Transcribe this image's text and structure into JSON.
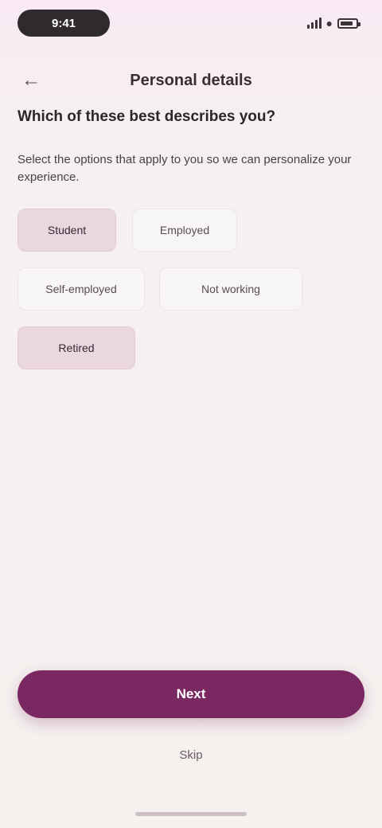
{
  "status_bar": {
    "time": "9:41"
  },
  "header": {
    "back_icon": "back-arrow-icon",
    "title": "Personal details"
  },
  "content": {
    "heading": "Which of these best describes you?",
    "description": "Select the options that apply to you so we can personalize your experience.",
    "chips": [
      {
        "label": "Student",
        "selected": true
      },
      {
        "label": "Employed",
        "selected": false
      },
      {
        "label": "Self-employed",
        "selected": false
      },
      {
        "label": "Not working",
        "selected": false
      },
      {
        "label": "Retired",
        "selected": true
      }
    ]
  },
  "footer": {
    "primary_label": "Next",
    "secondary_label": "Skip"
  },
  "colors": {
    "accent": "#7a2862",
    "chip_selected": "#ead7e0",
    "background": "#f6f0f1"
  }
}
